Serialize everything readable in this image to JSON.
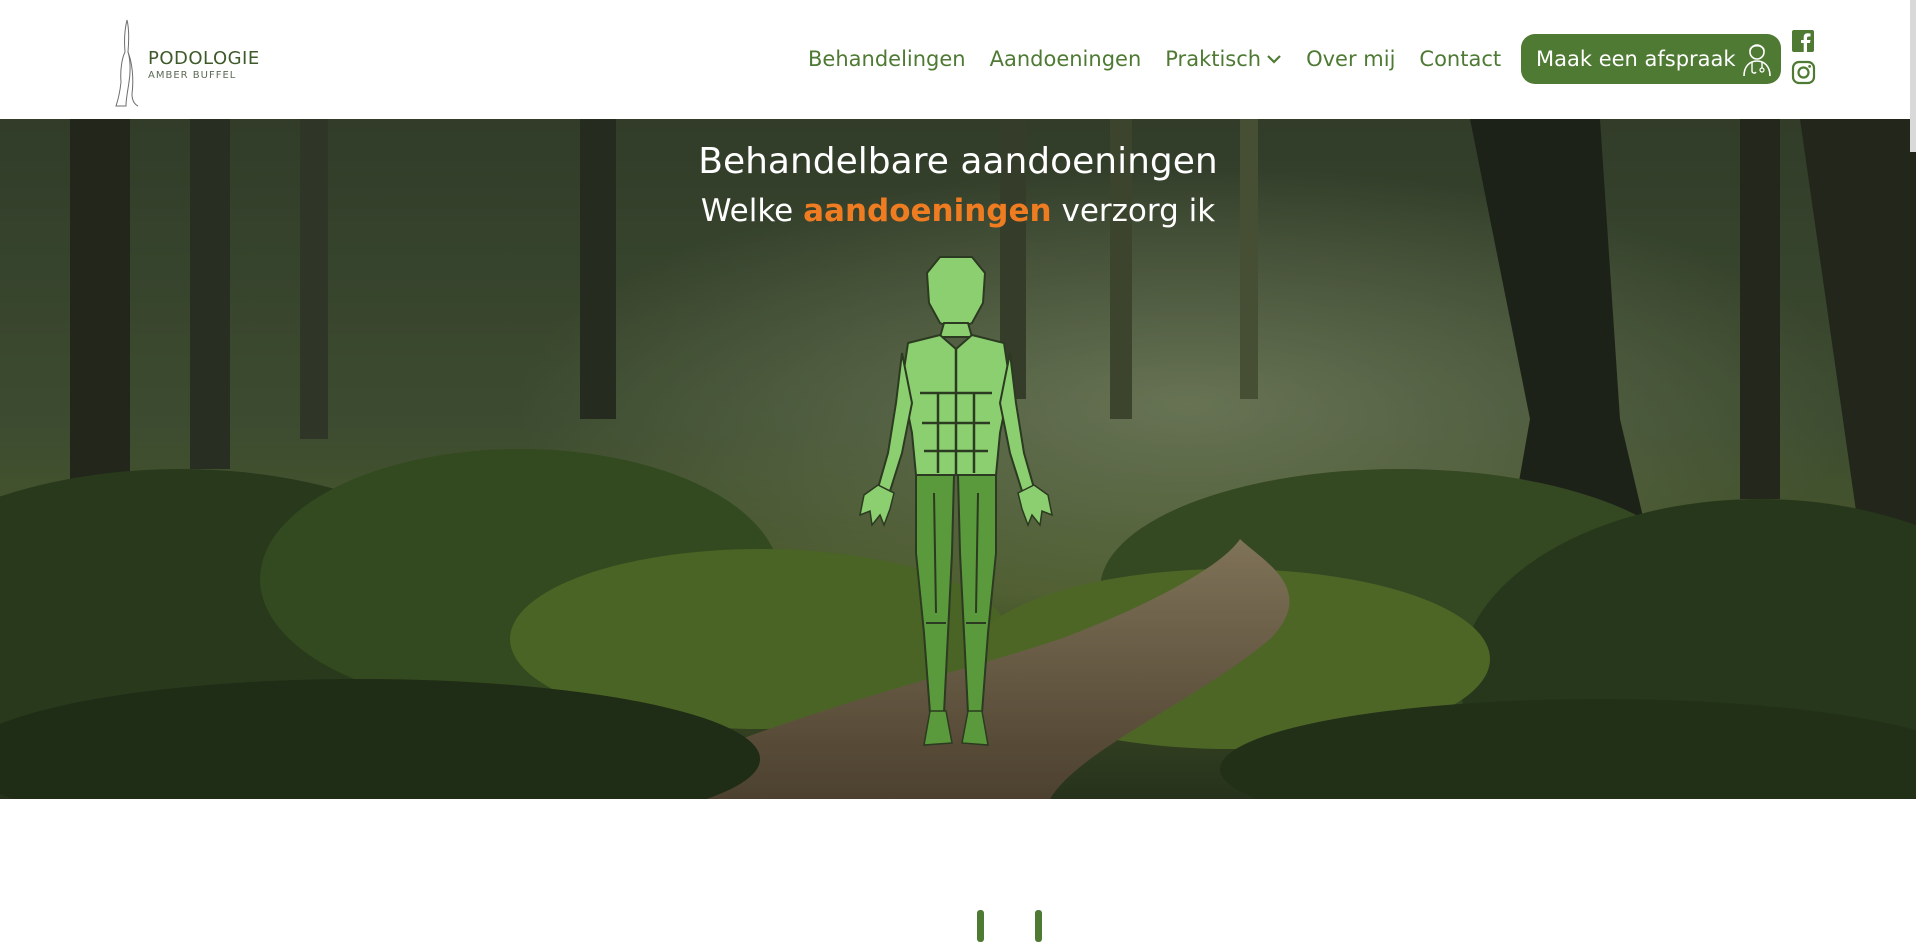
{
  "logo": {
    "title": "PODOLOGIE",
    "subtitle": "AMBER BUFFEL"
  },
  "nav": {
    "items": [
      {
        "label": "Behandelingen"
      },
      {
        "label": "Aandoeningen"
      },
      {
        "label": "Praktisch",
        "icon": "chevron-down-icon"
      },
      {
        "label": "Over mij"
      },
      {
        "label": "Contact"
      }
    ]
  },
  "cta": {
    "label": "Maak een afspraak",
    "icon": "doctor-icon"
  },
  "social": {
    "facebook_icon": "facebook-icon",
    "instagram_icon": "instagram-icon"
  },
  "hero": {
    "title": "Behandelbare aandoeningen",
    "subtitle_before": "Welke",
    "subtitle_accent": "aandoeningen",
    "subtitle_after": "verzorg ik"
  },
  "colors": {
    "brand_green": "#4e7a33",
    "accent_orange": "#f07c22",
    "figure_light_green": "#8ccf70",
    "figure_dark_green": "#5a9a3c"
  }
}
